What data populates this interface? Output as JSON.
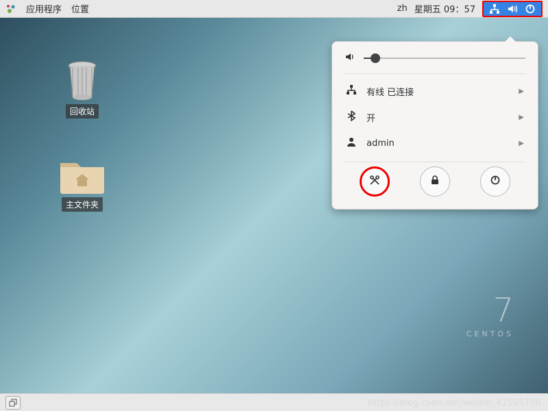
{
  "topbar": {
    "apps": "应用程序",
    "places": "位置",
    "lang": "zh",
    "date": "星期五 09：57"
  },
  "desktop": {
    "trash": "回收站",
    "home": "主文件夹"
  },
  "centos": {
    "seven": "7",
    "name": "CENTOS"
  },
  "popup": {
    "wired": "有线 已连接",
    "bluetooth": "开",
    "user": "admin"
  },
  "watermark": "https://blog.csdn.net/weixin_41595700"
}
